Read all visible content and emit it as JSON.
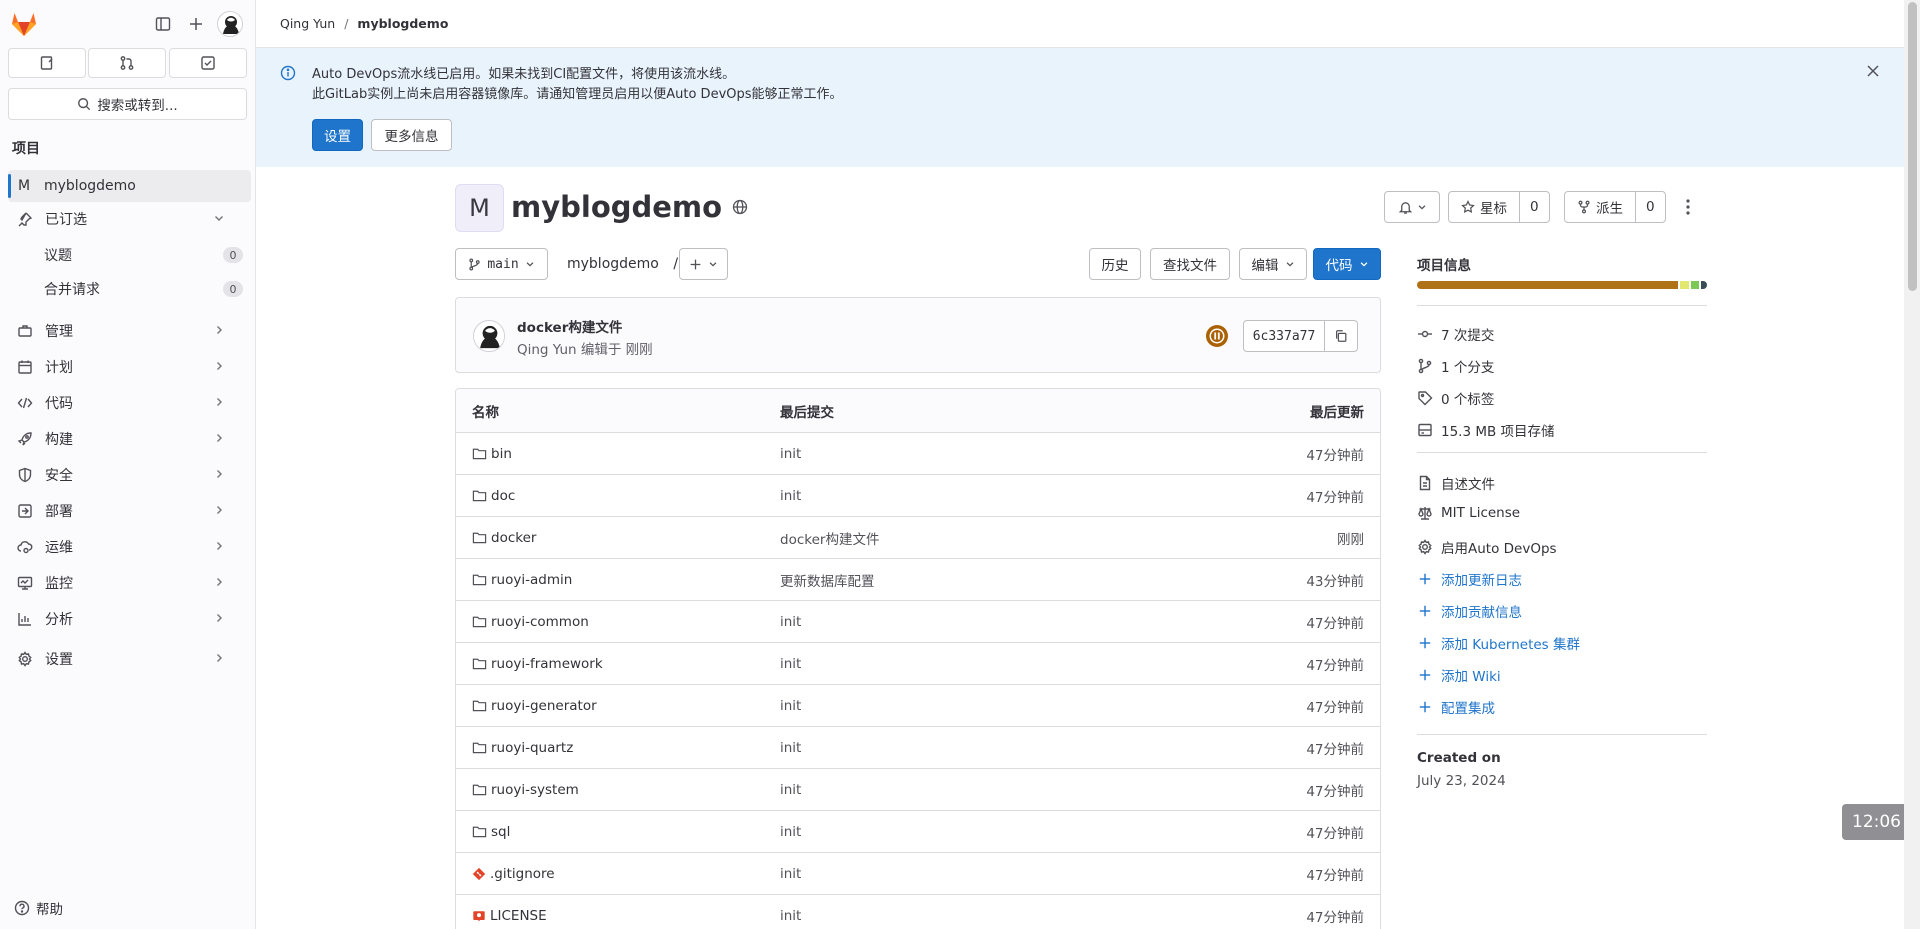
{
  "topbar": {
    "breadcrumb": [
      "Qing Yun",
      "myblogdemo"
    ]
  },
  "sidebar": {
    "search_label": "搜索或转到...",
    "section_label": "项目",
    "project_item": {
      "tile": "M",
      "label": "myblogdemo"
    },
    "pinned_label": "已订选",
    "pinned_items": [
      {
        "label": "议题",
        "count": "0"
      },
      {
        "label": "合并请求",
        "count": "0"
      }
    ],
    "items": [
      {
        "label": "管理",
        "icon": "briefcase-icon"
      },
      {
        "label": "计划",
        "icon": "calendar-icon"
      },
      {
        "label": "代码",
        "icon": "code-icon"
      },
      {
        "label": "构建",
        "icon": "rocket-icon"
      },
      {
        "label": "安全",
        "icon": "shield-icon"
      },
      {
        "label": "部署",
        "icon": "deploy-icon"
      },
      {
        "label": "运维",
        "icon": "cloud-gear-icon"
      },
      {
        "label": "监控",
        "icon": "monitor-icon"
      },
      {
        "label": "分析",
        "icon": "chart-icon"
      }
    ],
    "settings_label": "设置",
    "help_label": "帮助"
  },
  "banner": {
    "line1": "Auto DevOps流水线已启用。如果未找到CI配置文件，将使用该流水线。",
    "line2": "此GitLab实例上尚未启用容器镜像库。请通知管理员启用以便Auto DevOps能够正常工作。",
    "primary_button": "设置",
    "secondary_button": "更多信息"
  },
  "project": {
    "tile": "M",
    "name": "myblogdemo",
    "star_label": "星标",
    "star_count": "0",
    "fork_label": "派生",
    "fork_count": "0"
  },
  "toolbar": {
    "branch": "main",
    "path": "myblogdemo",
    "path_sep": "/",
    "history": "历史",
    "find_file": "查找文件",
    "edit": "编辑",
    "code": "代码"
  },
  "commit": {
    "title": "docker构建文件",
    "meta": "Qing Yun 编辑于 刚刚",
    "sha": "6c337a77",
    "status_color": "#ab6100"
  },
  "files": {
    "headers": [
      "名称",
      "最后提交",
      "最后更新"
    ],
    "rows": [
      {
        "name": "bin",
        "type": "folder",
        "msg": "init",
        "time": "47分钟前"
      },
      {
        "name": "doc",
        "type": "folder",
        "msg": "init",
        "time": "47分钟前"
      },
      {
        "name": "docker",
        "type": "folder",
        "msg": "docker构建文件",
        "time": "刚刚"
      },
      {
        "name": "ruoyi-admin",
        "type": "folder",
        "msg": "更新数据库配置",
        "time": "43分钟前"
      },
      {
        "name": "ruoyi-common",
        "type": "folder",
        "msg": "init",
        "time": "47分钟前"
      },
      {
        "name": "ruoyi-framework",
        "type": "folder",
        "msg": "init",
        "time": "47分钟前"
      },
      {
        "name": "ruoyi-generator",
        "type": "folder",
        "msg": "init",
        "time": "47分钟前"
      },
      {
        "name": "ruoyi-quartz",
        "type": "folder",
        "msg": "init",
        "time": "47分钟前"
      },
      {
        "name": "ruoyi-system",
        "type": "folder",
        "msg": "init",
        "time": "47分钟前"
      },
      {
        "name": "sql",
        "type": "folder",
        "msg": "init",
        "time": "47分钟前"
      },
      {
        "name": ".gitignore",
        "type": "git",
        "msg": "init",
        "time": "47分钟前"
      },
      {
        "name": "LICENSE",
        "type": "license",
        "msg": "init",
        "time": "47分钟前"
      }
    ]
  },
  "project_info": {
    "title": "项目信息",
    "language_colors": [
      "#b07219",
      "#e2e86f",
      "#7cc855",
      "#384d54"
    ],
    "language_shares": [
      0.92,
      0.03,
      0.03,
      0.02
    ],
    "stats": [
      {
        "label": "7 次提交",
        "icon": "commit-icon"
      },
      {
        "label": "1 个分支",
        "icon": "branch-icon"
      },
      {
        "label": "0 个标签",
        "icon": "tag-icon"
      },
      {
        "label": "15.3 MB 项目存储",
        "icon": "storage-icon"
      }
    ],
    "files": [
      {
        "label": "自述文件",
        "icon": "file-icon"
      },
      {
        "label": "MIT License",
        "icon": "scale-icon"
      },
      {
        "label": "启用Auto DevOps",
        "icon": "gear-icon"
      }
    ],
    "links": [
      "添加更新日志",
      "添加贡献信息",
      "添加 Kubernetes 集群",
      "添加 Wiki",
      "配置集成"
    ],
    "created_label": "Created on",
    "created_date": "July 23, 2024"
  },
  "clock": "12:06"
}
